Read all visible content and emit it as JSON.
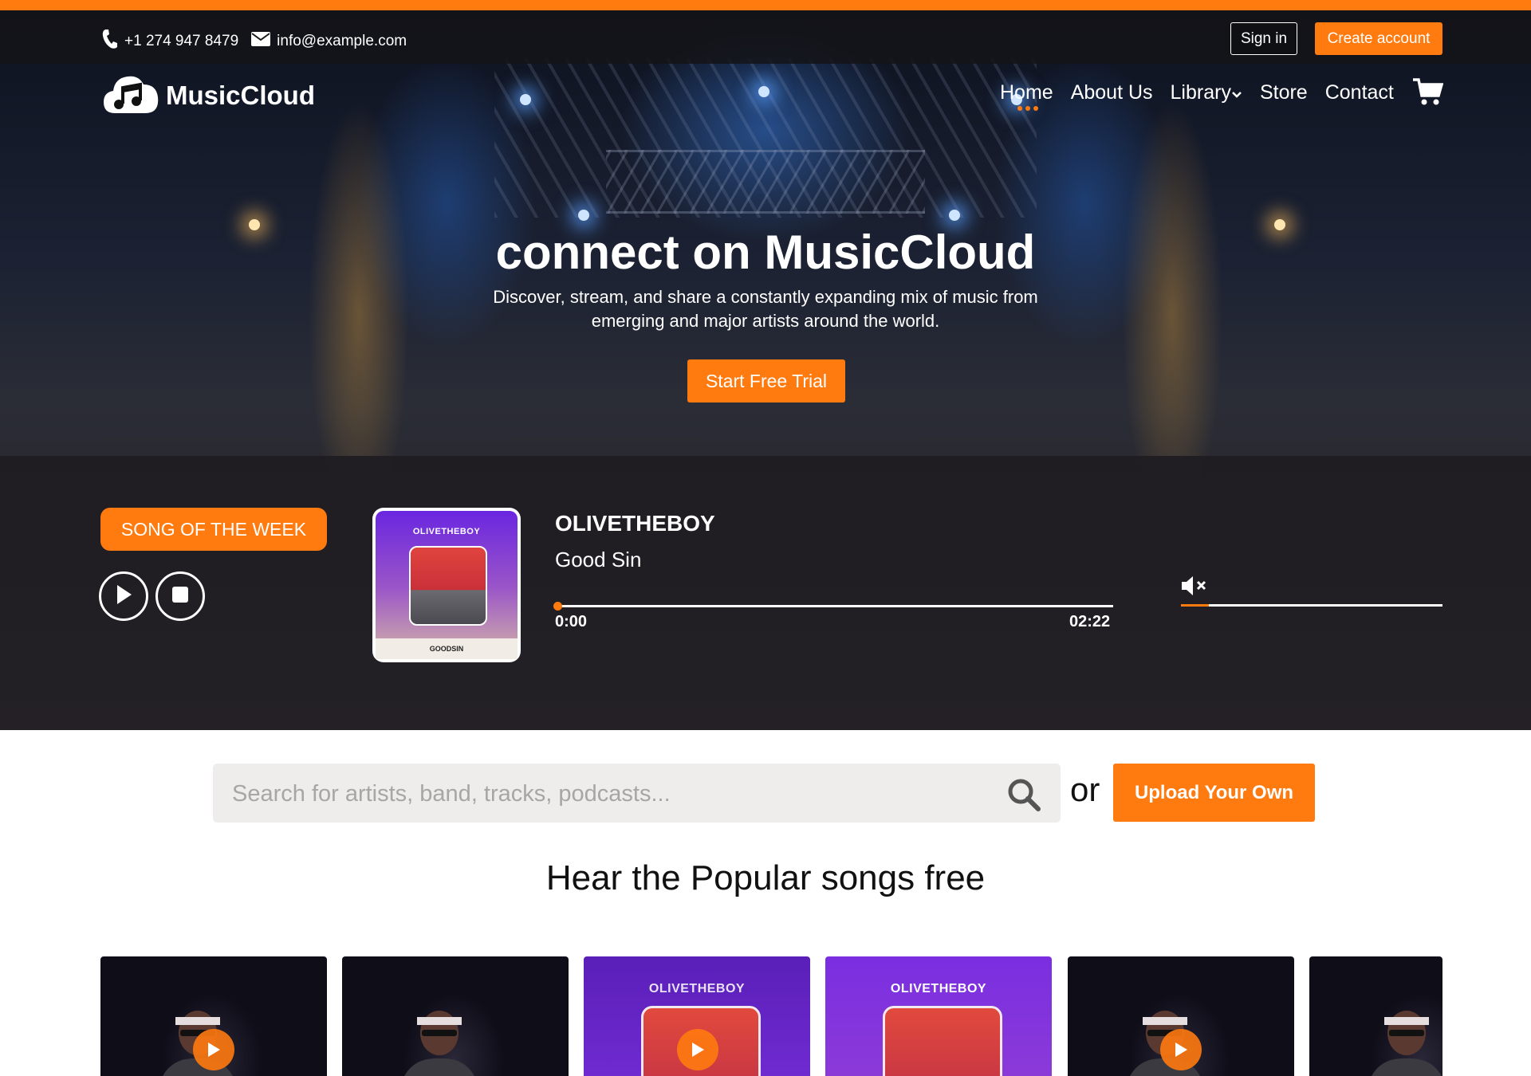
{
  "colors": {
    "accent": "#ff7a0f",
    "dark_band": "#242126",
    "search_bg": "#efedec"
  },
  "topbar": {
    "phone_icon": "phone-icon",
    "phone": "+1 274 947 8479",
    "email_icon": "envelope-icon",
    "email": "info@example.com",
    "signin_label": "Sign in",
    "create_label": "Create account"
  },
  "header": {
    "logo_icon": "cloud-music-note-icon",
    "logo_text": "MusicCloud",
    "nav": [
      {
        "label": "Home",
        "active": true
      },
      {
        "label": "About Us"
      },
      {
        "label": "Library",
        "has_dropdown": true
      },
      {
        "label": "Store"
      },
      {
        "label": "Contact"
      }
    ],
    "cart_icon": "cart-icon"
  },
  "hero": {
    "title": "connect on MusicCloud",
    "subtitle": "Discover, stream, and share a constantly expanding mix of music from emerging and major artists around the world.",
    "cta_label": "Start Free Trial"
  },
  "player": {
    "badge": "SONG OF THE WEEK",
    "play_icon": "play-icon",
    "stop_icon": "stop-icon",
    "cover_artist": "OLIVETHEBOY",
    "cover_title": "GOODSIN",
    "artist": "OLIVETHEBOY",
    "song": "Good Sin",
    "current_time": "0:00",
    "duration": "02:22",
    "progress": 0.0,
    "volume_icon": "volume-mute-icon",
    "volume": 0.1
  },
  "search": {
    "placeholder": "Search for artists, band, tracks, podcasts...",
    "search_icon": "search-icon",
    "or_text": "or",
    "upload_label": "Upload Your Own"
  },
  "popular": {
    "title": "Hear the Popular songs free",
    "cards": [
      {
        "style": "photo",
        "label": ""
      },
      {
        "style": "photo",
        "label": ""
      },
      {
        "style": "cover",
        "label": "OLIVETHEBOY"
      },
      {
        "style": "cover",
        "label": "OLIVETHEBOY"
      },
      {
        "style": "photo",
        "label": ""
      },
      {
        "style": "photo",
        "label": ""
      }
    ]
  }
}
